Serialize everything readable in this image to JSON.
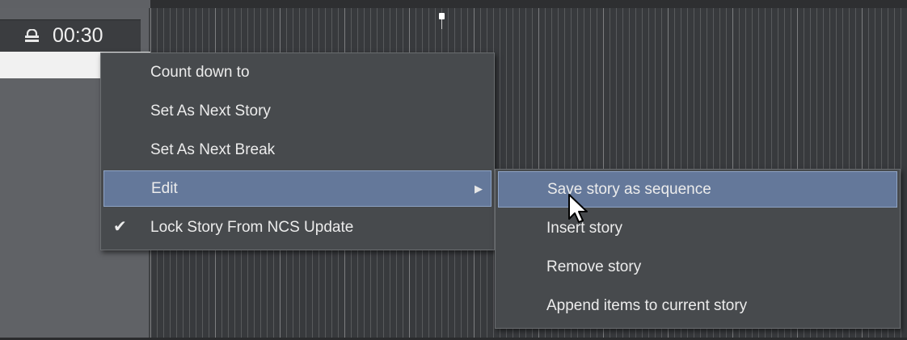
{
  "header": {
    "lock_icon": "lock-icon",
    "time": "00:30"
  },
  "context_menu": {
    "items": [
      {
        "label": "Count down to",
        "checked": false,
        "submenu": false,
        "highlighted": false
      },
      {
        "label": "Set As Next Story",
        "checked": false,
        "submenu": false,
        "highlighted": false
      },
      {
        "label": "Set As Next Break",
        "checked": false,
        "submenu": false,
        "highlighted": false
      },
      {
        "label": "Edit",
        "checked": false,
        "submenu": true,
        "highlighted": true
      },
      {
        "label": "Lock Story From NCS Update",
        "checked": true,
        "submenu": false,
        "highlighted": false
      }
    ],
    "check_glyph": "✔",
    "submenu_arrow_glyph": "▶"
  },
  "submenu": {
    "items": [
      {
        "label": "Save story as sequence",
        "highlighted": true
      },
      {
        "label": "Insert story",
        "highlighted": false
      },
      {
        "label": "Remove story",
        "highlighted": false
      },
      {
        "label": "Append items to current story",
        "highlighted": false
      }
    ]
  },
  "colors": {
    "highlight": "#64789a",
    "menu_bg": "#474a4d"
  }
}
